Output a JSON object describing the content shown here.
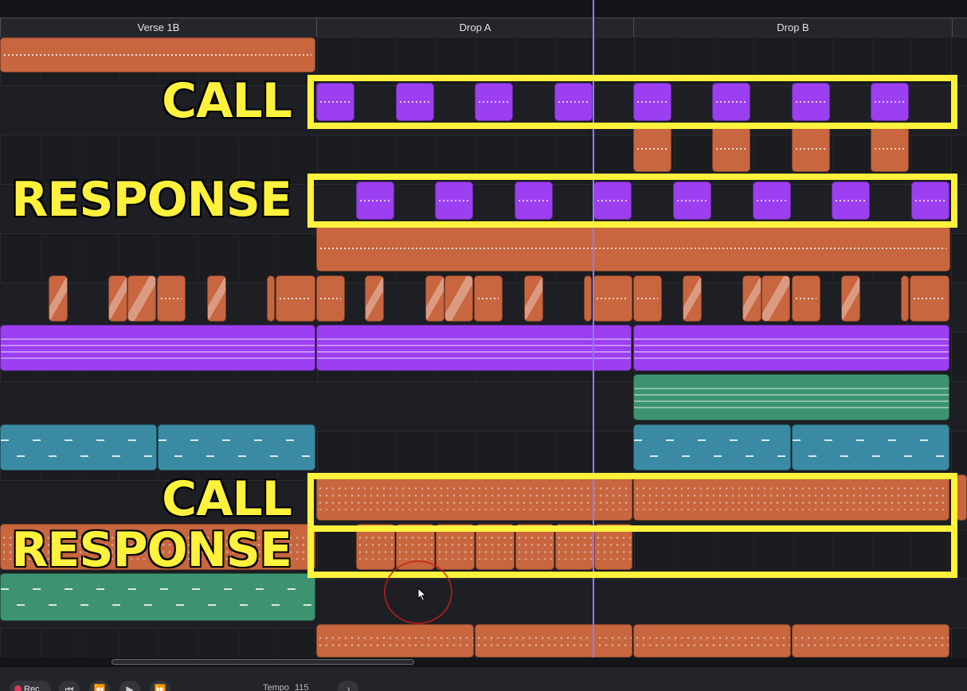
{
  "sections": [
    {
      "label": "Verse 1B"
    },
    {
      "label": "Drop A"
    },
    {
      "label": "Drop B"
    }
  ],
  "overlay": {
    "call_label": "CALL",
    "response_label": "RESPONSE",
    "highlight_color": "#fff13c"
  },
  "colors": {
    "audio_clip": "#c8663f",
    "purple_clip": "#9b3ff0",
    "teal_clip": "#3a8aa3",
    "green_clip": "#3d9370",
    "playhead": "#8e7cf0"
  },
  "transport": {
    "record_label": "Rec",
    "tempo_prefix": "Tempo",
    "tempo_value": "115",
    "icons": [
      "record-icon",
      "skip-back-icon",
      "rewind-icon",
      "play-icon",
      "fast-forward-icon",
      "metronome-icon"
    ]
  }
}
